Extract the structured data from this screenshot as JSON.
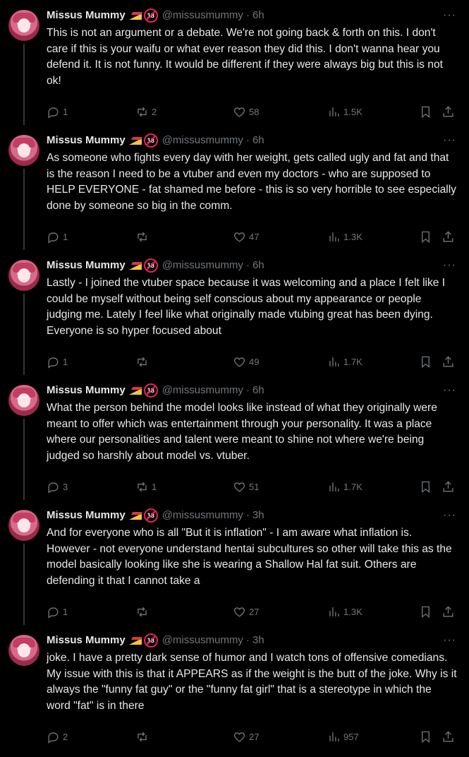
{
  "author": {
    "name": "Missus Mummy",
    "handle": "@missusmummy",
    "badge_cake_icon": "cake-slice-icon",
    "badge_18_label": "18",
    "more_label": "···"
  },
  "tweets": [
    {
      "time": "6h",
      "text": "This is not an argument or a debate. We're not going back & forth on this. I don't care if this is your waifu or what ever reason they did this. I don't wanna hear you defend it. It is not funny. It would be different if they were always big but this is not ok!",
      "replies": "1",
      "reposts": "2",
      "likes": "58",
      "views": "1.5K"
    },
    {
      "time": "6h",
      "text": "As someone who fights every day with her weight, gets called ugly and fat and that is the reason I need to be a vtuber and even my doctors - who are supposed to HELP EVERYONE - fat shamed me before - this is so very horrible to see especially done by someone so big in the comm.",
      "replies": "1",
      "reposts": "",
      "likes": "47",
      "views": "1.3K"
    },
    {
      "time": "6h",
      "text": "Lastly - I joined the vtuber space because it was welcoming and a place I felt like I could be myself without being self conscious about my appearance or people judging me. Lately I feel like what originally made vtubing great has been dying. Everyone is so hyper focused about",
      "replies": "1",
      "reposts": "",
      "likes": "49",
      "views": "1.7K"
    },
    {
      "time": "6h",
      "text": "What the person behind the model looks like instead of what they originally were meant to offer which was entertainment through your personality. It was a place where our personalities and talent were meant to shine not where we're being judged so harshly about model vs. vtuber.",
      "replies": "3",
      "reposts": "1",
      "likes": "51",
      "views": "1.7K"
    },
    {
      "time": "3h",
      "text": "And for everyone who is all \"But it is inflation\" - I am aware what inflation is. However - not everyone understand hentai subcultures so other will take this as the model basically looking like she is wearing a Shallow Hal fat suit. Others are defending it that I cannot take a",
      "replies": "1",
      "reposts": "",
      "likes": "27",
      "views": "1.3K"
    },
    {
      "time": "3h",
      "text": "joke. I have a pretty dark sense of humor and I watch tons of offensive comedians. My issue with this is that it APPEARS as if the weight is the butt of the joke. Why is it always the \"funny fat guy\" or the \"funny fat girl\" that is a stereotype in which the word \"fat\" is in there",
      "replies": "2",
      "reposts": "",
      "likes": "27",
      "views": "957"
    }
  ],
  "colors": {
    "background": "#000000",
    "text": "#e7e9ea",
    "muted": "#71767b",
    "thread_line": "#333639",
    "badge_red": "#e0245e"
  }
}
